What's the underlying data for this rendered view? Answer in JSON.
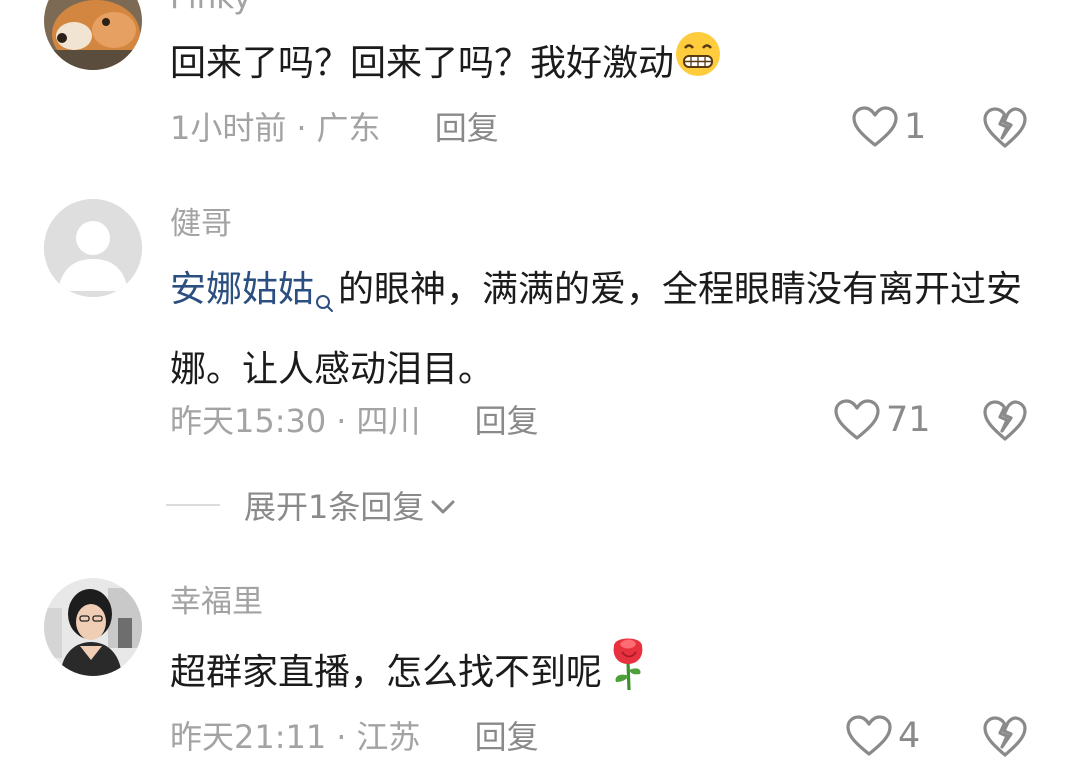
{
  "comments": [
    {
      "username": "Pinky",
      "text": "回来了吗？回来了吗？我好激动",
      "emoji": "grinning-face-emoji",
      "time": "1小时前",
      "location": "广东",
      "reply_label": "回复",
      "likes": "1"
    },
    {
      "username": "健哥",
      "mention": "安娜姑姑",
      "text": "的眼神，满满的爱，全程眼睛没有离开过安娜。让人感动泪目。",
      "time": "昨天15:30",
      "location": "四川",
      "reply_label": "回复",
      "likes": "71",
      "expand_label": "展开1条回复"
    },
    {
      "username": "幸福里",
      "text": "超群家直播，怎么找不到呢",
      "emoji": "rose-emoji",
      "time": "昨天21:11",
      "location": "江苏",
      "reply_label": "回复",
      "likes": "4"
    }
  ],
  "separator": "·",
  "colors": {
    "mention": "#2b4f80",
    "meta": "#a3a3a3",
    "text": "#1b1b1b"
  }
}
